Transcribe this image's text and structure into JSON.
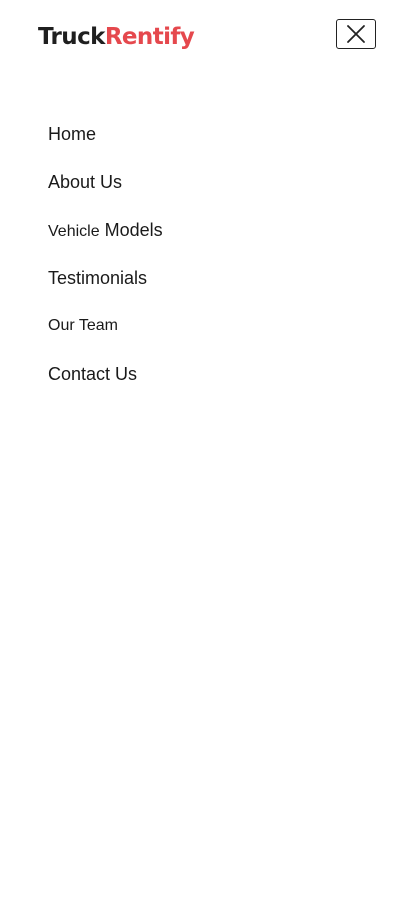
{
  "brand": {
    "part1": "Truck",
    "part2": "Rentify",
    "accent_color": "#e5484d",
    "dark_color": "#1f1f1f"
  },
  "header": {
    "close_icon": "close-icon"
  },
  "nav": {
    "items": [
      {
        "label": "Home"
      },
      {
        "label": "About Us"
      },
      {
        "label_prefix": "Vehicle",
        "label_suffix": "Models"
      },
      {
        "label": "Testimonials"
      },
      {
        "label": "Our Team"
      },
      {
        "label": "Contact Us"
      }
    ]
  }
}
